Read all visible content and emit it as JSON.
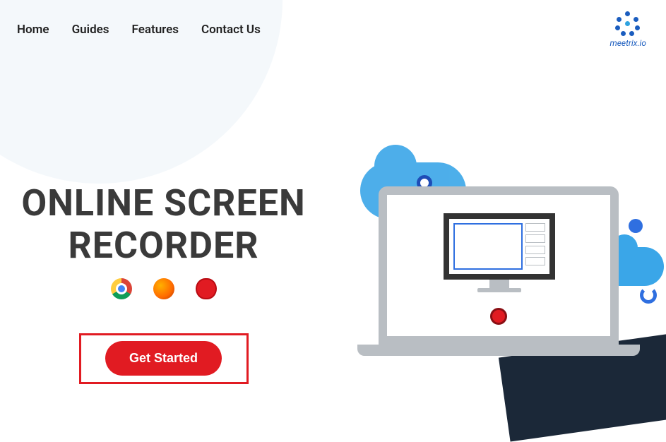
{
  "nav": {
    "items": [
      "Home",
      "Guides",
      "Features",
      "Contact Us"
    ]
  },
  "brand": {
    "text": "meetrix.io"
  },
  "hero": {
    "title_line1": "ONLINE SCREEN",
    "title_line2": "RECORDER",
    "cta_label": "Get Started"
  },
  "icons": {
    "chrome": "chrome-icon",
    "firefox": "firefox-icon",
    "opera": "opera-icon"
  }
}
